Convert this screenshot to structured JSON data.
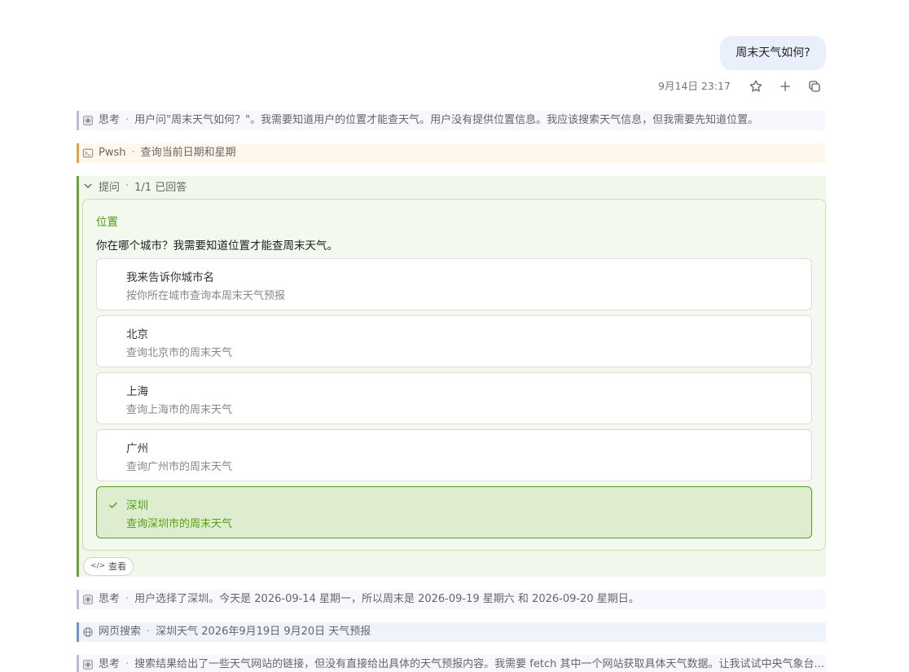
{
  "user_message": "周末天气如何?",
  "message_meta": {
    "time": "9月14日 23:17"
  },
  "steps_before": [
    {
      "kind": "think",
      "icon": "brain-icon",
      "label": "思考",
      "text": "用户问\"周末天气如何？\"。我需要知道用户的位置才能查天气。用户没有提供位置信息。我应该搜索天气信息，但我需要先知道位置。"
    },
    {
      "kind": "pwsh",
      "icon": "terminal-icon",
      "label": "Pwsh",
      "text": "查询当前日期和星期"
    }
  ],
  "ask": {
    "label": "提问",
    "status": "1/1 已回答",
    "question_title": "位置",
    "question_text": "你在哪个城市？我需要知道位置才能查周末天气。",
    "options": [
      {
        "label": "我来告诉你城市名",
        "desc": "按你所在城市查询本周末天气预报",
        "selected": false
      },
      {
        "label": "北京",
        "desc": "查询北京市的周末天气",
        "selected": false
      },
      {
        "label": "上海",
        "desc": "查询上海市的周末天气",
        "selected": false
      },
      {
        "label": "广州",
        "desc": "查询广州市的周末天气",
        "selected": false
      },
      {
        "label": "深圳",
        "desc": "查询深圳市的周末天气",
        "selected": true
      }
    ],
    "view_button": "查看"
  },
  "steps_after": [
    {
      "kind": "think",
      "icon": "brain-icon",
      "label": "思考",
      "text": "用户选择了深圳。今天是 2026-09-14 星期一，所以周末是 2026-09-19 星期六 和 2026-09-20 星期日。"
    },
    {
      "kind": "web",
      "icon": "globe-icon",
      "label": "网页搜索",
      "text": "深圳天气 2026年9月19日 9月20日 天气预报"
    },
    {
      "kind": "think",
      "icon": "brain-icon",
      "label": "思考",
      "text": "搜索结果给出了一些天气网站的链接，但没有直接给出具体的天气预报内容。我需要 fetch 其中一个网站获取具体天气数据。让我试试中央气象台..."
    }
  ]
}
